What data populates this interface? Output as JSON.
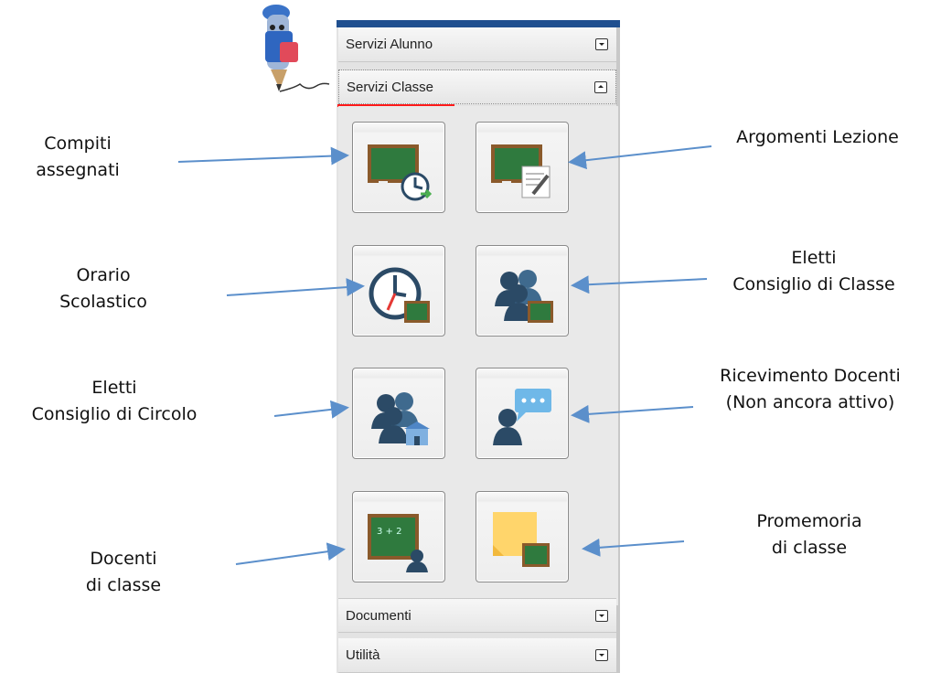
{
  "panel": {
    "sections": [
      {
        "label": "Servizi Alunno",
        "expanded": false
      },
      {
        "label": "Servizi Classe",
        "expanded": true
      },
      {
        "label": "Documenti",
        "expanded": false
      },
      {
        "label": "Utilità",
        "expanded": false
      }
    ],
    "buttons": [
      {
        "icon": "blackboard-clock-icon"
      },
      {
        "icon": "blackboard-pencil-icon"
      },
      {
        "icon": "clock-blackboard-icon"
      },
      {
        "icon": "group-blackboard-icon"
      },
      {
        "icon": "group-school-icon"
      },
      {
        "icon": "person-speech-bubble-icon"
      },
      {
        "icon": "blackboard-person-icon"
      },
      {
        "icon": "sticky-note-blackboard-icon"
      }
    ]
  },
  "annotations": {
    "compiti": [
      "Compiti",
      "assegnati"
    ],
    "argomenti": [
      "Argomenti Lezione"
    ],
    "orario": [
      "Orario",
      "Scolastico"
    ],
    "eletti_classe": [
      "Eletti",
      "Consiglio di Classe"
    ],
    "eletti_circolo": [
      "Eletti",
      "Consiglio di Circolo"
    ],
    "ricevimento": [
      "Ricevimento Docenti",
      "(Non ancora attivo)"
    ],
    "docenti": [
      "Docenti",
      "di classe"
    ],
    "promemoria": [
      "Promemoria",
      "di classe"
    ]
  },
  "colors": {
    "blackboard": "#2f7a3e",
    "frame": "#8a5a2b",
    "person": "#2b4a66",
    "arrow": "#5b8fcb",
    "highlight": "#ff1a1a"
  }
}
